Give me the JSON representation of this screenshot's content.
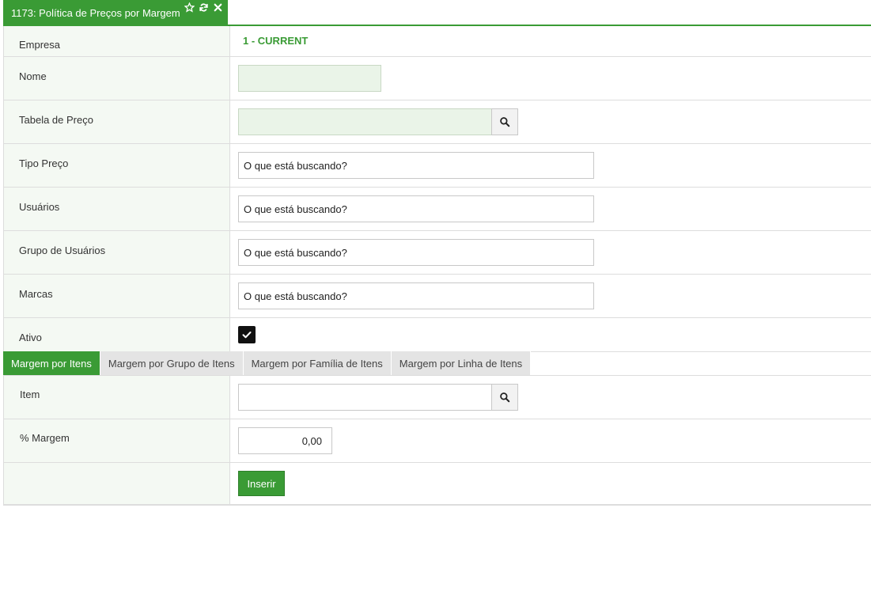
{
  "page_tab": {
    "title": "1173: Política de Preços por Margem"
  },
  "form": {
    "empresa": {
      "label": "Empresa",
      "value": "1 - CURRENT"
    },
    "nome": {
      "label": "Nome",
      "value": ""
    },
    "tabela_preco": {
      "label": "Tabela de Preço",
      "value": ""
    },
    "tipo_preco": {
      "label": "Tipo Preço",
      "placeholder": "O que está buscando?"
    },
    "usuarios": {
      "label": "Usuários",
      "placeholder": "O que está buscando?"
    },
    "grupo_usuarios": {
      "label": "Grupo de Usuários",
      "placeholder": "O que está buscando?"
    },
    "marcas": {
      "label": "Marcas",
      "placeholder": "O que está buscando?"
    },
    "ativo": {
      "label": "Ativo",
      "checked": true
    }
  },
  "tabs": [
    {
      "label": "Margem por Itens",
      "active": true
    },
    {
      "label": "Margem por Grupo de Itens",
      "active": false
    },
    {
      "label": "Margem por Família de Itens",
      "active": false
    },
    {
      "label": "Margem por Linha de Itens",
      "active": false
    }
  ],
  "margin_form": {
    "item": {
      "label": "Item",
      "value": ""
    },
    "margem": {
      "label": "% Margem",
      "value": "0,00"
    },
    "insert_label": "Inserir"
  },
  "colors": {
    "accent": "#3a9b35",
    "label_bg": "#f4f9f3",
    "input_green": "#eaf4e8"
  }
}
